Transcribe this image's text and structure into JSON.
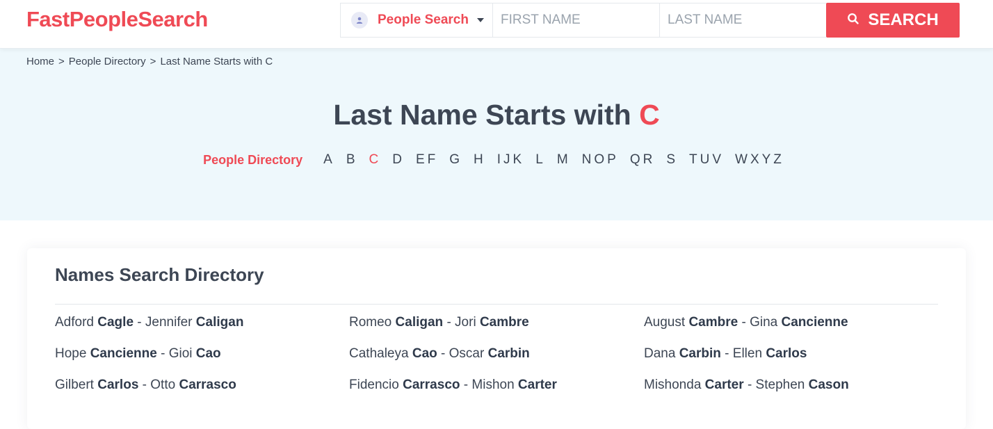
{
  "brand": {
    "logo_text": "FastPeopleSearch",
    "accent": "#ef4a55"
  },
  "search": {
    "type_label": "People Search",
    "first_placeholder": "FIRST NAME",
    "last_placeholder": "LAST NAME",
    "button_label": "SEARCH"
  },
  "breadcrumb": {
    "home": "Home",
    "sep1": ">",
    "directory": "People Directory",
    "sep2": ">",
    "current": "Last Name Starts with C"
  },
  "hero": {
    "title_prefix": "Last Name Starts with",
    "title_letter": "C",
    "directory_link": "People Directory",
    "letters": [
      "A",
      "B",
      "C",
      "D",
      "EF",
      "G",
      "H",
      "IJK",
      "L",
      "M",
      "NOP",
      "QR",
      "S",
      "TUV",
      "WXYZ"
    ],
    "active_letter": "C"
  },
  "directory": {
    "title": "Names Search Directory",
    "entries": [
      [
        {
          "first1": "Adford",
          "last1": "Cagle",
          "sep": "-",
          "first2": "Jennifer",
          "last2": "Caligan"
        },
        {
          "first1": "Romeo",
          "last1": "Caligan",
          "sep": "-",
          "first2": "Jori",
          "last2": "Cambre"
        },
        {
          "first1": "August",
          "last1": "Cambre",
          "sep": "-",
          "first2": "Gina",
          "last2": "Cancienne"
        }
      ],
      [
        {
          "first1": "Hope",
          "last1": "Cancienne",
          "sep": "-",
          "first2": "Gioi",
          "last2": "Cao"
        },
        {
          "first1": "Cathaleya",
          "last1": "Cao",
          "sep": "-",
          "first2": "Oscar",
          "last2": "Carbin"
        },
        {
          "first1": "Dana",
          "last1": "Carbin",
          "sep": "-",
          "first2": "Ellen",
          "last2": "Carlos"
        }
      ],
      [
        {
          "first1": "Gilbert",
          "last1": "Carlos",
          "sep": "-",
          "first2": "Otto",
          "last2": "Carrasco"
        },
        {
          "first1": "Fidencio",
          "last1": "Carrasco",
          "sep": "-",
          "first2": "Mishon",
          "last2": "Carter"
        },
        {
          "first1": "Mishonda",
          "last1": "Carter",
          "sep": "-",
          "first2": "Stephen",
          "last2": "Cason"
        }
      ]
    ]
  }
}
